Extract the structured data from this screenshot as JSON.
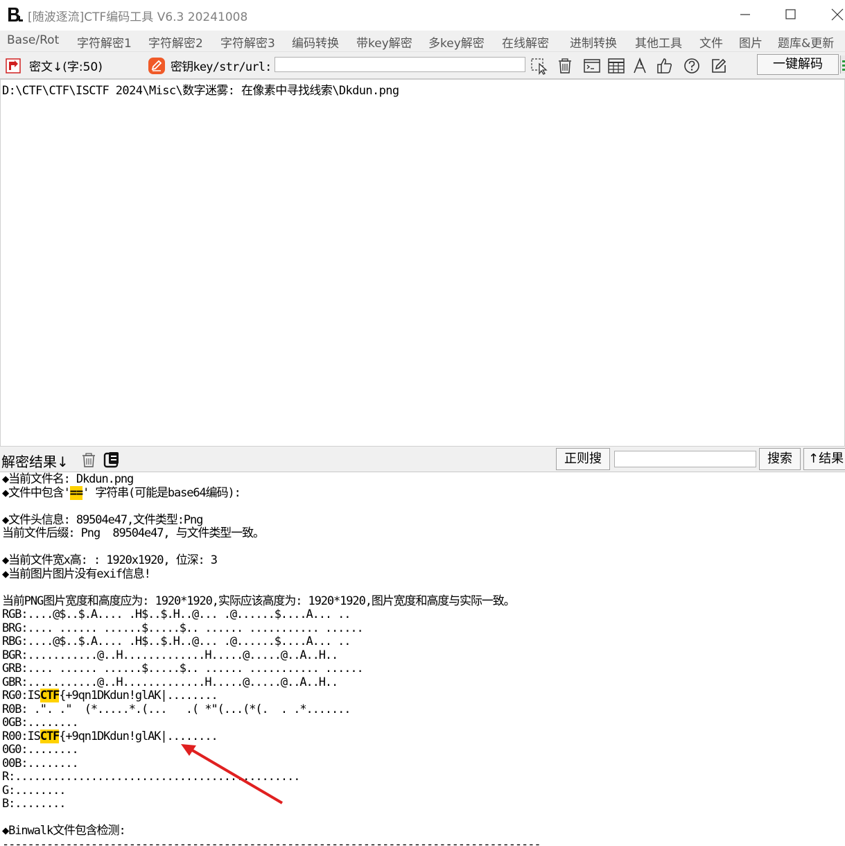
{
  "window": {
    "title": "[随波逐流]CTF编码工具 V6.3 20241008"
  },
  "menu": {
    "items": [
      "Base/Rot",
      "字符解密1",
      "字符解密2",
      "字符解密3",
      "编码转换",
      "带key解密",
      "多key解密",
      "在线解密",
      "进制转换",
      "其他工具",
      "文件",
      "图片",
      "题库&更新"
    ]
  },
  "toolbar": {
    "cipher_label": "密文↓(字:50)",
    "key_label": "密钥key/str/url:",
    "key_value": "",
    "decode_button": "一键解码",
    "icons": [
      "select-icon",
      "trash-icon",
      "terminal-icon",
      "table-icon",
      "font-icon",
      "thumbs-up-icon",
      "help-icon",
      "edit-icon"
    ]
  },
  "cipher": {
    "text": "D:\\CTF\\CTF\\ISCTF 2024\\Misc\\数字迷雾: 在像素中寻找线索\\Dkdun.png"
  },
  "result_bar": {
    "label": "解密结果↓",
    "regex_button": "正则搜",
    "search_value": "",
    "search_button": "搜索",
    "result_up_button": "↑结果"
  },
  "results": {
    "lines": [
      "◆当前文件名: Dkdun.png",
      "◆文件中包含'==' 字符串(可能是base64编码):",
      "",
      "◆文件头信息: 89504e47,文件类型:Png",
      "当前文件后缀: Png  89504e47, 与文件类型一致。",
      "",
      "◆当前文件宽x高: : 1920x1920, 位深: 3",
      "◆当前图片图片没有exif信息!",
      "",
      "当前PNG图片宽度和高度应为: 1920*1920,实际应该高度为: 1920*1920,图片宽度和高度与实际一致。",
      "RGB:....@$..$.A.... .H$..$.H..@... .@......$....A... ..",
      "BRG:.... ...... ......$.....$.. ...... ........... ......",
      "RBG:....@$..$.A.... .H$..$.H..@... .@......$....A... ..",
      "BGR:...........@..H.............H.....@.....@..A..H..",
      "GRB:.... ...... ......$.....$.. ...... ........... ......",
      "GBR:...........@..H.............H.....@.....@..A..H..",
      "RG0:ISCTF{+9qn1DKdun!glAK|........",
      "R0B: .\". .\"  (*.....*.(...   .( *\"(...(*(.  . .*.......",
      "0GB:........",
      "R00:ISCTF{+9qn1DKdun!glAK|........",
      "0G0:........",
      "00B:........",
      "R:.............................................",
      "G:........",
      "B:........",
      "",
      "◆Binwalk文件包含检测:",
      "-------------------------------------------------------------------------------------"
    ],
    "highlight_terms": [
      "==",
      "CTF"
    ],
    "highlight_color": "#ffd200"
  },
  "colors": {
    "arrow": "#e02020",
    "key_icon_bg": "#f05a28",
    "cipher_icon": "#d02020"
  }
}
